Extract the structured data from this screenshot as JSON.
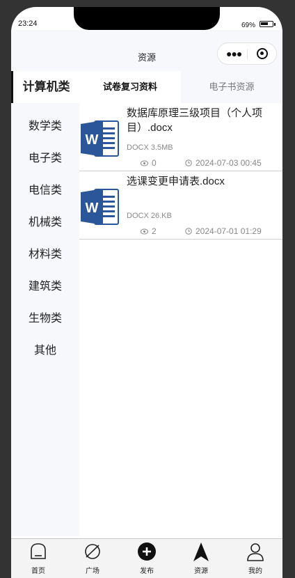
{
  "status_bar": {
    "time": "23:24",
    "battery": "69%",
    "battery_level": 0.69
  },
  "navbar": {
    "title": "资源"
  },
  "sidebar": {
    "items": [
      {
        "label": "计算机类",
        "active": true
      },
      {
        "label": "数学类"
      },
      {
        "label": "电子类"
      },
      {
        "label": "电信类"
      },
      {
        "label": "机械类"
      },
      {
        "label": "材料类"
      },
      {
        "label": "建筑类"
      },
      {
        "label": "生物类"
      },
      {
        "label": "其他"
      }
    ]
  },
  "tabs": [
    {
      "label": "试卷复习资料",
      "active": true
    },
    {
      "label": "电子书资源"
    }
  ],
  "files": [
    {
      "title": "数据库原理三级项目（个人项目）.docx",
      "size": "DOCX 3.5MB",
      "views": "0",
      "date": "2024-07-03 00:45",
      "icon": "word-doc-icon"
    },
    {
      "title": "选课变更申请表.docx",
      "size": "DOCX 26.KB",
      "views": "2",
      "date": "2024-07-01 01:29",
      "icon": "word-doc-icon"
    }
  ],
  "tabbar": {
    "items": [
      {
        "label": "首页",
        "icon": "home-icon"
      },
      {
        "label": "广场",
        "icon": "planet-icon"
      },
      {
        "label": "发布",
        "icon": "plus-circle-icon"
      },
      {
        "label": "资源",
        "icon": "navigation-arrow-icon",
        "active": true
      },
      {
        "label": "我的",
        "icon": "user-icon"
      }
    ]
  },
  "colors": {
    "accent": "#111111",
    "word_blue": "#2b579a",
    "sidebar_bg": "#f7f8fc",
    "meta_text": "#888888"
  }
}
